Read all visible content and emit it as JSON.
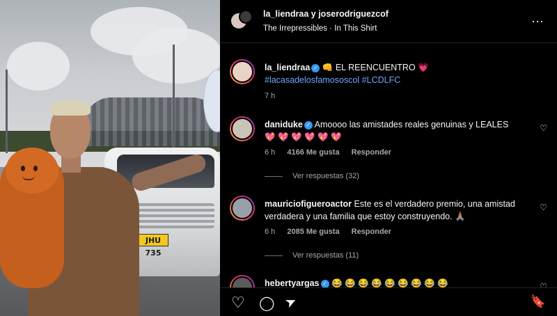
{
  "media": {
    "plate_text": "JHU 735"
  },
  "header": {
    "names": "la_liendraa y joserodriguezcof",
    "audio": "The Irrepressibles · In This Shirt",
    "more_icon": "⋯"
  },
  "caption": {
    "username": "la_liendraa",
    "text": " 👊 EL REENCUENTRO 💗",
    "hashtags": "#lacasadelosfamososcol #LCDLFC",
    "time": "7 h"
  },
  "comments": [
    {
      "username": "daniduke",
      "text": " Amoooo las amistades reales genuinas y LEALES",
      "text2": "💖 💖 💖 💖 💖 💖",
      "time": "6 h",
      "likes": "4166 Me gusta",
      "reply": "Responder",
      "view_replies": "Ver respuestas (32)"
    },
    {
      "username": "mauriciofigueroactor",
      "text": " Este es el verdadero premio, una amistad",
      "text2": "verdadera y una familia que estoy construyendo. 🙏🏽",
      "time": "6 h",
      "likes": "2085 Me gusta",
      "reply": "Responder",
      "view_replies": "Ver respuestas (11)"
    },
    {
      "username": "hebertyargas",
      "text": " 😂 😂 😂 😂 😂 😂 😂 😂 😂"
    }
  ],
  "icons": {
    "heart": "♡",
    "comment": "◯",
    "share": "➤",
    "save": "🔖"
  },
  "colors": {
    "link": "#6fa8ff",
    "verified": "#3897f0"
  }
}
